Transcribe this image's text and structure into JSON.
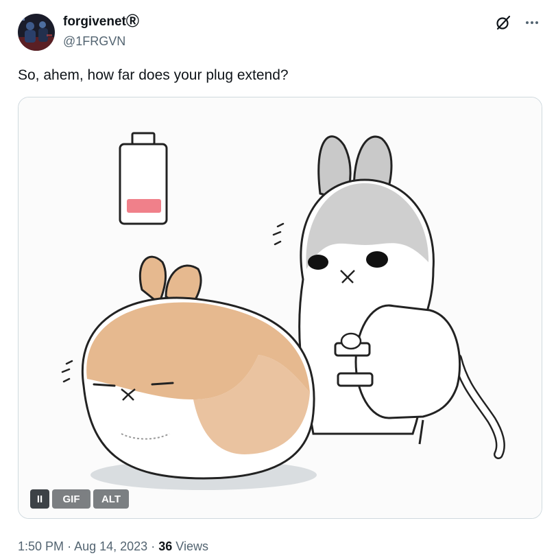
{
  "author": {
    "display_name": "forgivenetⓇ",
    "handle": "@1FRGVN",
    "avatar_icon": "profile-photo"
  },
  "header_icons": [
    "grok-icon",
    "more-icon"
  ],
  "tweet": {
    "text": "So, ahem, how far does your plug extend?"
  },
  "media": {
    "type": "gif",
    "pause_label": "II",
    "gif_label": "GIF",
    "alt_label": "ALT",
    "accent_colors": {
      "bunny_tan": "#e6b98f",
      "bunny_grey": "#c9c9c9",
      "battery_low": "#f0808a"
    }
  },
  "meta": {
    "time": "1:50 PM",
    "separator": "·",
    "date": "Aug 14, 2023",
    "views_count": "36",
    "views_label": "Views"
  }
}
